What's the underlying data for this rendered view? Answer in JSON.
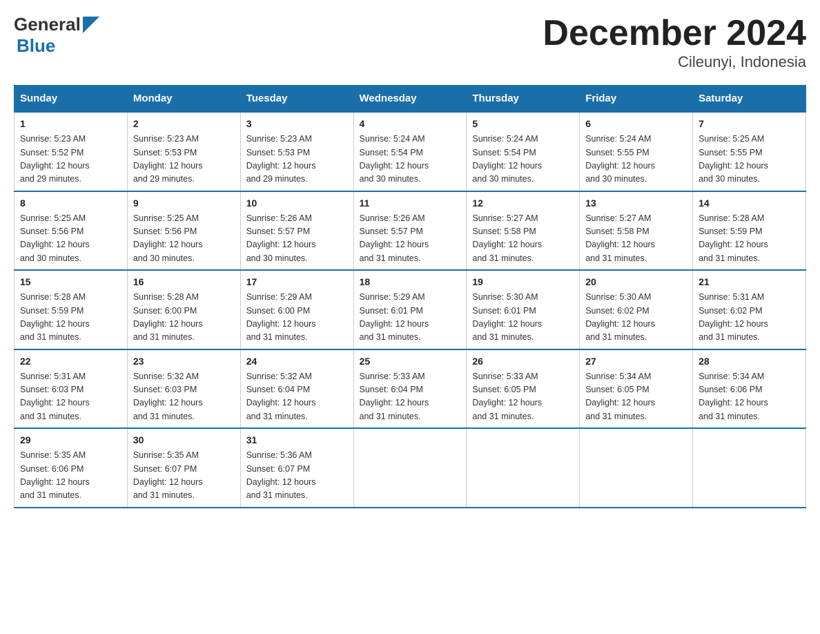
{
  "header": {
    "logo_general": "General",
    "logo_blue": "Blue",
    "month_title": "December 2024",
    "location": "Cileunyi, Indonesia"
  },
  "weekdays": [
    "Sunday",
    "Monday",
    "Tuesday",
    "Wednesday",
    "Thursday",
    "Friday",
    "Saturday"
  ],
  "weeks": [
    [
      {
        "day": "1",
        "sunrise": "5:23 AM",
        "sunset": "5:52 PM",
        "daylight": "12 hours and 29 minutes."
      },
      {
        "day": "2",
        "sunrise": "5:23 AM",
        "sunset": "5:53 PM",
        "daylight": "12 hours and 29 minutes."
      },
      {
        "day": "3",
        "sunrise": "5:23 AM",
        "sunset": "5:53 PM",
        "daylight": "12 hours and 29 minutes."
      },
      {
        "day": "4",
        "sunrise": "5:24 AM",
        "sunset": "5:54 PM",
        "daylight": "12 hours and 30 minutes."
      },
      {
        "day": "5",
        "sunrise": "5:24 AM",
        "sunset": "5:54 PM",
        "daylight": "12 hours and 30 minutes."
      },
      {
        "day": "6",
        "sunrise": "5:24 AM",
        "sunset": "5:55 PM",
        "daylight": "12 hours and 30 minutes."
      },
      {
        "day": "7",
        "sunrise": "5:25 AM",
        "sunset": "5:55 PM",
        "daylight": "12 hours and 30 minutes."
      }
    ],
    [
      {
        "day": "8",
        "sunrise": "5:25 AM",
        "sunset": "5:56 PM",
        "daylight": "12 hours and 30 minutes."
      },
      {
        "day": "9",
        "sunrise": "5:25 AM",
        "sunset": "5:56 PM",
        "daylight": "12 hours and 30 minutes."
      },
      {
        "day": "10",
        "sunrise": "5:26 AM",
        "sunset": "5:57 PM",
        "daylight": "12 hours and 30 minutes."
      },
      {
        "day": "11",
        "sunrise": "5:26 AM",
        "sunset": "5:57 PM",
        "daylight": "12 hours and 31 minutes."
      },
      {
        "day": "12",
        "sunrise": "5:27 AM",
        "sunset": "5:58 PM",
        "daylight": "12 hours and 31 minutes."
      },
      {
        "day": "13",
        "sunrise": "5:27 AM",
        "sunset": "5:58 PM",
        "daylight": "12 hours and 31 minutes."
      },
      {
        "day": "14",
        "sunrise": "5:28 AM",
        "sunset": "5:59 PM",
        "daylight": "12 hours and 31 minutes."
      }
    ],
    [
      {
        "day": "15",
        "sunrise": "5:28 AM",
        "sunset": "5:59 PM",
        "daylight": "12 hours and 31 minutes."
      },
      {
        "day": "16",
        "sunrise": "5:28 AM",
        "sunset": "6:00 PM",
        "daylight": "12 hours and 31 minutes."
      },
      {
        "day": "17",
        "sunrise": "5:29 AM",
        "sunset": "6:00 PM",
        "daylight": "12 hours and 31 minutes."
      },
      {
        "day": "18",
        "sunrise": "5:29 AM",
        "sunset": "6:01 PM",
        "daylight": "12 hours and 31 minutes."
      },
      {
        "day": "19",
        "sunrise": "5:30 AM",
        "sunset": "6:01 PM",
        "daylight": "12 hours and 31 minutes."
      },
      {
        "day": "20",
        "sunrise": "5:30 AM",
        "sunset": "6:02 PM",
        "daylight": "12 hours and 31 minutes."
      },
      {
        "day": "21",
        "sunrise": "5:31 AM",
        "sunset": "6:02 PM",
        "daylight": "12 hours and 31 minutes."
      }
    ],
    [
      {
        "day": "22",
        "sunrise": "5:31 AM",
        "sunset": "6:03 PM",
        "daylight": "12 hours and 31 minutes."
      },
      {
        "day": "23",
        "sunrise": "5:32 AM",
        "sunset": "6:03 PM",
        "daylight": "12 hours and 31 minutes."
      },
      {
        "day": "24",
        "sunrise": "5:32 AM",
        "sunset": "6:04 PM",
        "daylight": "12 hours and 31 minutes."
      },
      {
        "day": "25",
        "sunrise": "5:33 AM",
        "sunset": "6:04 PM",
        "daylight": "12 hours and 31 minutes."
      },
      {
        "day": "26",
        "sunrise": "5:33 AM",
        "sunset": "6:05 PM",
        "daylight": "12 hours and 31 minutes."
      },
      {
        "day": "27",
        "sunrise": "5:34 AM",
        "sunset": "6:05 PM",
        "daylight": "12 hours and 31 minutes."
      },
      {
        "day": "28",
        "sunrise": "5:34 AM",
        "sunset": "6:06 PM",
        "daylight": "12 hours and 31 minutes."
      }
    ],
    [
      {
        "day": "29",
        "sunrise": "5:35 AM",
        "sunset": "6:06 PM",
        "daylight": "12 hours and 31 minutes."
      },
      {
        "day": "30",
        "sunrise": "5:35 AM",
        "sunset": "6:07 PM",
        "daylight": "12 hours and 31 minutes."
      },
      {
        "day": "31",
        "sunrise": "5:36 AM",
        "sunset": "6:07 PM",
        "daylight": "12 hours and 31 minutes."
      },
      null,
      null,
      null,
      null
    ]
  ],
  "labels": {
    "sunrise": "Sunrise:",
    "sunset": "Sunset:",
    "daylight": "Daylight:"
  }
}
